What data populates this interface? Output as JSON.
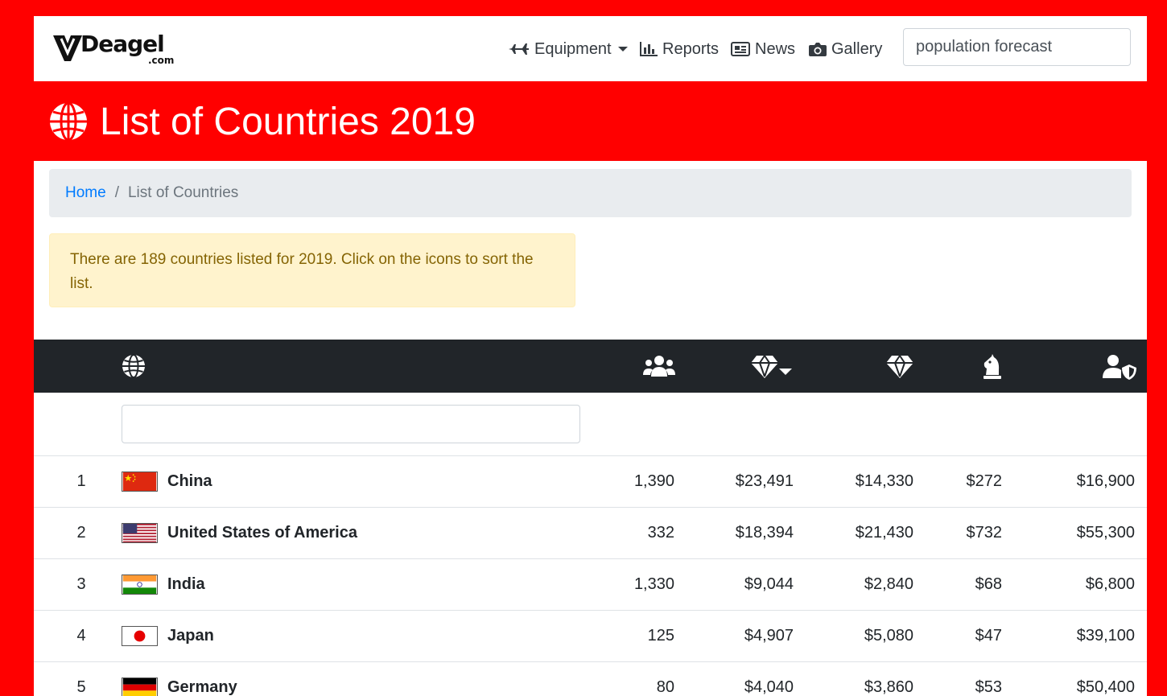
{
  "brand": {
    "logo_text": "Deagel",
    "logo_sub": ".com"
  },
  "nav": {
    "items": [
      {
        "label": "Equipment",
        "icon": "plane-icon",
        "has_caret": true
      },
      {
        "label": "Reports",
        "icon": "bar-chart-icon"
      },
      {
        "label": "News",
        "icon": "newspaper-icon"
      },
      {
        "label": "Gallery",
        "icon": "camera-icon"
      }
    ],
    "search_value": "population forecast"
  },
  "page": {
    "title": "List of Countries 2019",
    "title_icon": "globe-icon"
  },
  "breadcrumb": {
    "home": "Home",
    "separator": "/",
    "current": "List of Countries"
  },
  "alert": {
    "text": "There are 189 countries listed for 2019. Click on the icons to sort the list."
  },
  "table": {
    "header_icons": [
      "globe-icon",
      "users-icon",
      "gem-sort-icon",
      "gem-icon",
      "chess-knight-icon",
      "user-shield-icon"
    ],
    "filter_value": "",
    "rows": [
      {
        "rank": "1",
        "flag": "china",
        "name": "China",
        "population": "1,390",
        "gdp_ppp": "$23,491",
        "gdp": "$14,330",
        "military": "$272",
        "per_capita": "$16,900"
      },
      {
        "rank": "2",
        "flag": "usa",
        "name": "United States of America",
        "population": "332",
        "gdp_ppp": "$18,394",
        "gdp": "$21,430",
        "military": "$732",
        "per_capita": "$55,300"
      },
      {
        "rank": "3",
        "flag": "india",
        "name": "India",
        "population": "1,330",
        "gdp_ppp": "$9,044",
        "gdp": "$2,840",
        "military": "$68",
        "per_capita": "$6,800"
      },
      {
        "rank": "4",
        "flag": "japan",
        "name": "Japan",
        "population": "125",
        "gdp_ppp": "$4,907",
        "gdp": "$5,080",
        "military": "$47",
        "per_capita": "$39,100"
      },
      {
        "rank": "5",
        "flag": "germany",
        "name": "Germany",
        "population": "80",
        "gdp_ppp": "$4,040",
        "gdp": "$3,860",
        "military": "$53",
        "per_capita": "$50,400"
      }
    ]
  },
  "colors": {
    "background": "#ff0000",
    "header_dark": "#212529",
    "link": "#007bff",
    "alert_bg": "#fff3cd",
    "alert_text": "#856404",
    "breadcrumb_bg": "#e9ecef"
  }
}
